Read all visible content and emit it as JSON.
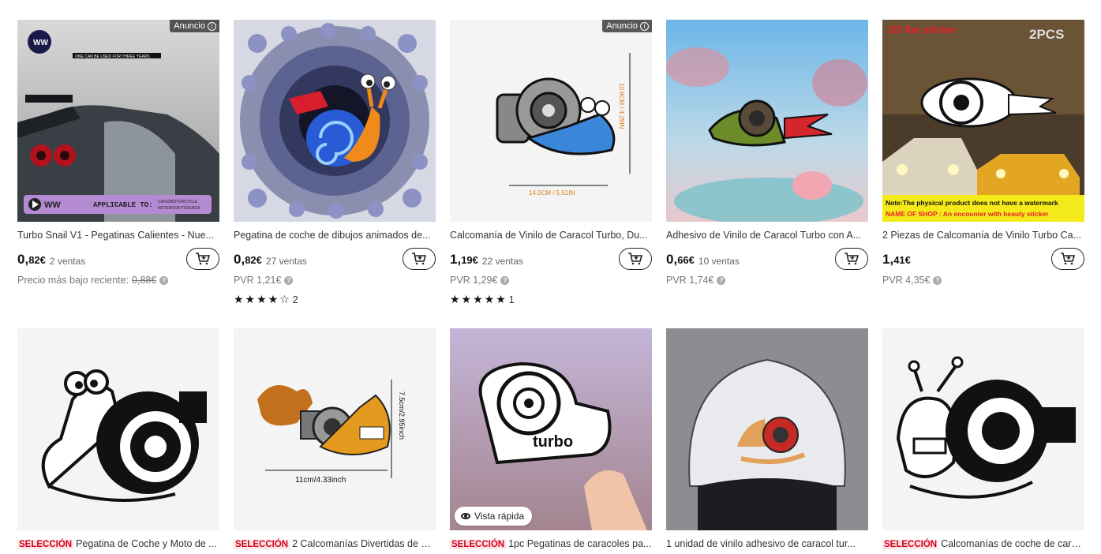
{
  "products_row1": [
    {
      "title": "Turbo Snail V1 - Pegatinas Calientes - Nue...",
      "price_int": "0,",
      "price_dec": "82€",
      "sold": "2 ventas",
      "ad_label": "Anuncio",
      "sub_prefix": "Precio más bajo reciente: ",
      "sub_value": "0,88€",
      "image_texts": {
        "top": "ONE CAN BE USED FOR THREE YEARS",
        "brand": "WW",
        "applicable": "APPLICABLE TO:",
        "car_sticker": "CAR STICKER",
        "uses": "CARS/MOTORCYCLE NOTEBOOK/TOOLBOX"
      }
    },
    {
      "title": "Pegatina de coche de dibujos animados de...",
      "price_int": "0,",
      "price_dec": "82€",
      "sold": "27 ventas",
      "sub_value": "PVR 1,21€",
      "stars": "★★★★☆",
      "rating_count": "2"
    },
    {
      "title": "Calcomanía de Vinilo de Caracol Turbo, Du...",
      "price_int": "1,",
      "price_dec": "19€",
      "sold": "22 ventas",
      "ad_label": "Anuncio",
      "sub_value": "PVR 1,29€",
      "stars": "★★★★★",
      "rating_count": "1",
      "image_texts": {
        "height": "10.9CM / 4.29IN",
        "width": "14.0CM / 5.51IN"
      }
    },
    {
      "title": "Adhesivo de Vinilo de Caracol Turbo con A...",
      "price_int": "0,",
      "price_dec": "66€",
      "sold": "10 ventas",
      "sub_value": "PVR 1,74€"
    },
    {
      "title": "2 Piezas de Calcomanía de Vinilo Turbo Ca...",
      "price_int": "1,",
      "price_dec": "41€",
      "sold": "",
      "sub_value": "PVR 4,35€",
      "image_texts": {
        "tag": "2D flat sticker",
        "pcs": "2PCS",
        "note": "Note:The physical product does not have a watermark",
        "shop": "NAME OF SHOP : An encounter with beauty sticker"
      }
    }
  ],
  "products_row2": [
    {
      "badge": "SELECCIÓN",
      "title": "Pegatina de Coche y Moto de ..."
    },
    {
      "badge": "SELECCIÓN",
      "title": "2 Calcomanías Divertidas de C...",
      "image_texts": {
        "height": "7.5cm/2.95inch",
        "width": "11cm/4.33inch"
      }
    },
    {
      "badge": "SELECCIÓN",
      "title": "1pc Pegatinas de caracoles pa...",
      "quick_view": "Vista rápida",
      "image_texts": {
        "word": "turbo"
      }
    },
    {
      "badge": "",
      "title": "1 unidad de vinilo adhesivo de caracol tur..."
    },
    {
      "badge": "SELECCIÓN",
      "title": "Calcomanías de coche de cara..."
    }
  ],
  "colors": {
    "accent": "#d0021b",
    "badge_bg": "#ffe4e7"
  }
}
